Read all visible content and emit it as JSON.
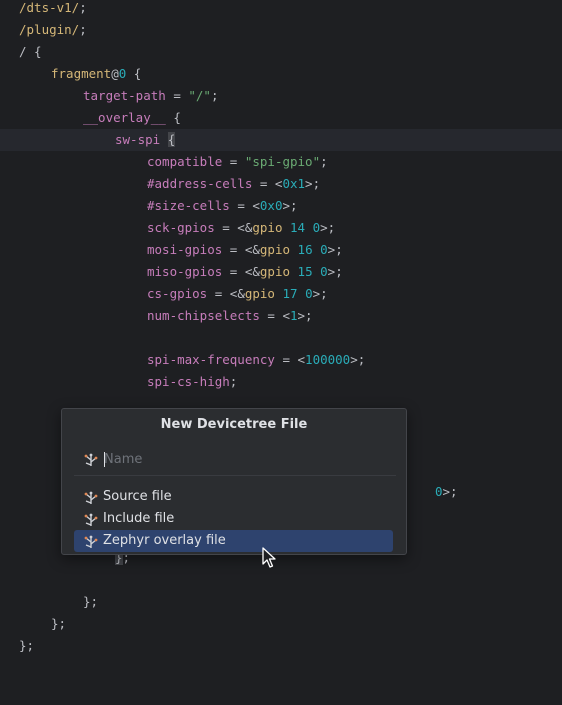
{
  "editor": {
    "lines": [
      {
        "indent": 0,
        "tokens": [
          [
            "kw",
            "/dts-v1/"
          ],
          [
            "txt",
            ";"
          ]
        ]
      },
      {
        "indent": 0,
        "tokens": [
          [
            "kw",
            "/plugin/"
          ],
          [
            "txt",
            ";"
          ]
        ]
      },
      {
        "indent": 0,
        "tokens": [
          [
            "txt",
            "/ {"
          ]
        ]
      },
      {
        "indent": 1,
        "tokens": [
          [
            "kw",
            "fragment"
          ],
          [
            "txt",
            "@"
          ],
          [
            "num",
            "0"
          ],
          [
            "txt",
            " {"
          ]
        ]
      },
      {
        "indent": 2,
        "tokens": [
          [
            "prop",
            "target-path"
          ],
          [
            "txt",
            " = "
          ],
          [
            "str",
            "\"/\""
          ],
          [
            "txt",
            ";"
          ]
        ]
      },
      {
        "indent": 2,
        "tokens": [
          [
            "prop",
            "__overlay__"
          ],
          [
            "txt",
            " {"
          ]
        ]
      },
      {
        "indent": 3,
        "current": true,
        "tokens": [
          [
            "node",
            "sw-spi"
          ],
          [
            "txt",
            " "
          ],
          [
            "caret-hl",
            "{"
          ]
        ]
      },
      {
        "indent": 4,
        "tokens": [
          [
            "prop",
            "compatible"
          ],
          [
            "txt",
            " = "
          ],
          [
            "str",
            "\"spi-gpio\""
          ],
          [
            "txt",
            ";"
          ]
        ]
      },
      {
        "indent": 4,
        "tokens": [
          [
            "prop",
            "#address-cells"
          ],
          [
            "txt",
            " = <"
          ],
          [
            "num",
            "0x1"
          ],
          [
            "txt",
            ">;"
          ]
        ]
      },
      {
        "indent": 4,
        "tokens": [
          [
            "prop",
            "#size-cells"
          ],
          [
            "txt",
            " = <"
          ],
          [
            "num",
            "0x0"
          ],
          [
            "txt",
            ">;"
          ]
        ]
      },
      {
        "indent": 4,
        "tokens": [
          [
            "prop",
            "sck-gpios"
          ],
          [
            "txt",
            " = <&"
          ],
          [
            "ref",
            "gpio"
          ],
          [
            "txt",
            " "
          ],
          [
            "num",
            "14"
          ],
          [
            "txt",
            " "
          ],
          [
            "num",
            "0"
          ],
          [
            "txt",
            ">;"
          ]
        ]
      },
      {
        "indent": 4,
        "tokens": [
          [
            "prop",
            "mosi-gpios"
          ],
          [
            "txt",
            " = <&"
          ],
          [
            "ref",
            "gpio"
          ],
          [
            "txt",
            " "
          ],
          [
            "num",
            "16"
          ],
          [
            "txt",
            " "
          ],
          [
            "num",
            "0"
          ],
          [
            "txt",
            ">;"
          ]
        ]
      },
      {
        "indent": 4,
        "tokens": [
          [
            "prop",
            "miso-gpios"
          ],
          [
            "txt",
            " = <&"
          ],
          [
            "ref",
            "gpio"
          ],
          [
            "txt",
            " "
          ],
          [
            "num",
            "15"
          ],
          [
            "txt",
            " "
          ],
          [
            "num",
            "0"
          ],
          [
            "txt",
            ">;"
          ]
        ]
      },
      {
        "indent": 4,
        "tokens": [
          [
            "prop",
            "cs-gpios"
          ],
          [
            "txt",
            " = <&"
          ],
          [
            "ref",
            "gpio"
          ],
          [
            "txt",
            " "
          ],
          [
            "num",
            "17"
          ],
          [
            "txt",
            " "
          ],
          [
            "num",
            "0"
          ],
          [
            "txt",
            ">;"
          ]
        ]
      },
      {
        "indent": 4,
        "tokens": [
          [
            "prop",
            "num-chipselects"
          ],
          [
            "txt",
            " = <"
          ],
          [
            "num",
            "1"
          ],
          [
            "txt",
            ">;"
          ]
        ]
      },
      {
        "indent": 4,
        "tokens": []
      },
      {
        "indent": 4,
        "tokens": [
          [
            "prop",
            "spi-max-frequency"
          ],
          [
            "txt",
            " = <"
          ],
          [
            "num",
            "100000"
          ],
          [
            "txt",
            ">;"
          ]
        ]
      },
      {
        "indent": 4,
        "tokens": [
          [
            "prop",
            "spi-cs-high"
          ],
          [
            "txt",
            ";"
          ]
        ]
      },
      {
        "indent": 0,
        "tokens": []
      },
      {
        "indent": 0,
        "tokens": []
      },
      {
        "indent": 0,
        "tokens": []
      },
      {
        "indent": 0,
        "tokens": []
      },
      {
        "indent": 13,
        "tokens": [
          [
            "num",
            "0"
          ],
          [
            "txt",
            ">;"
          ]
        ]
      },
      {
        "indent": 0,
        "tokens": []
      },
      {
        "indent": 0,
        "tokens": []
      },
      {
        "indent": 3,
        "tokens": [
          [
            "caret-hl",
            "}"
          ],
          [
            "txt",
            ";"
          ]
        ]
      },
      {
        "indent": 0,
        "tokens": []
      },
      {
        "indent": 2,
        "tokens": [
          [
            "txt",
            "};"
          ]
        ]
      },
      {
        "indent": 1,
        "tokens": [
          [
            "txt",
            "};"
          ]
        ]
      },
      {
        "indent": 0,
        "tokens": [
          [
            "txt",
            "};"
          ]
        ]
      }
    ]
  },
  "popup": {
    "title": "New Devicetree File",
    "name_placeholder": "Name",
    "name_value": "",
    "icon": "devicetree-icon",
    "items": [
      {
        "label": "Source file",
        "selected": false
      },
      {
        "label": "Include file",
        "selected": false
      },
      {
        "label": "Zephyr overlay file",
        "selected": true
      }
    ]
  },
  "colors": {
    "background": "#1e1f22",
    "popup_background": "#2b2d30",
    "selection": "#2e436e",
    "keyword": "#d5b778",
    "property": "#c77dbb",
    "string": "#6aab73",
    "number": "#2aacb8"
  }
}
